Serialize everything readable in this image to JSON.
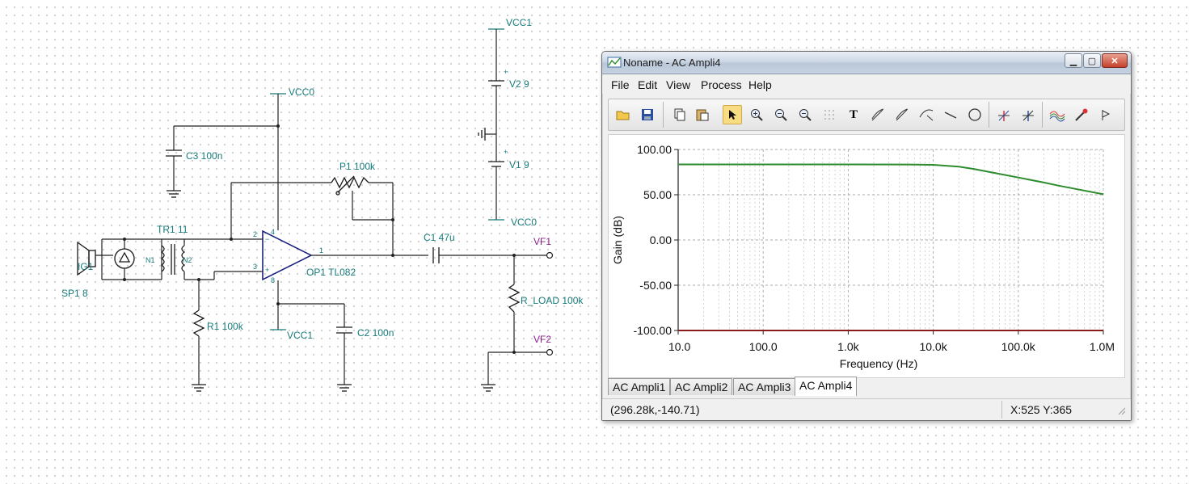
{
  "schematic": {
    "labels": {
      "vcc1_top": "VCC1",
      "v2": "V2 9",
      "v1": "V1 9",
      "vcc0_bottom": "VCC0",
      "vcc0_top": "VCC0",
      "c3": "C3 100n",
      "p1": "P1 100k",
      "tr1": "TR1 11",
      "n1": "N1",
      "n2": "N2",
      "ig1": "IG1",
      "sp1": "SP1 8",
      "r1": "R1 100k",
      "op1": "OP1 TL082",
      "vcc1_bottom": "VCC1",
      "c2": "C2 100n",
      "c1": "C1 47u",
      "vf1": "VF1",
      "vf2": "VF2",
      "r_load": "R_LOAD 100k",
      "pin1": "1",
      "pin2": "2",
      "pin3": "3",
      "pin4": "4",
      "pin8": "8",
      "plus": "+",
      "minus": "−"
    }
  },
  "window": {
    "title": "Noname - AC Ampli4",
    "caption_buttons": {
      "minimize": "▁",
      "maximize": "▢",
      "close": "✕"
    },
    "menu": [
      "File",
      "Edit",
      "View",
      "Process",
      "Help"
    ],
    "toolbar_icons": [
      "open-icon",
      "save-icon",
      "copy-icon",
      "paste-icon",
      "pointer-icon",
      "zoom-in-icon",
      "zoom-out-icon",
      "zoom-100-icon",
      "grid-icon",
      "text-icon",
      "cursor-a-icon",
      "cursor-b-icon",
      "tangent-icon",
      "line-icon",
      "circle-icon",
      "marker-a-icon",
      "marker-b-icon",
      "curves-icon",
      "probe-icon",
      "flag-icon"
    ],
    "tabs": [
      "AC Ampli1",
      "AC Ampli2",
      "AC Ampli3",
      "AC Ampli4"
    ],
    "active_tab": "AC Ampli4",
    "status": {
      "coords": "(296.28k,-140.71)",
      "xy": "X:525  Y:365"
    }
  },
  "chart_data": {
    "type": "line",
    "title": "",
    "xlabel": "Frequency (Hz)",
    "ylabel": "Gain (dB)",
    "x_scale": "log",
    "xlim": [
      10,
      1000000
    ],
    "ylim": [
      -100,
      100
    ],
    "x_ticks": [
      "10.0",
      "100.0",
      "1.0k",
      "10.0k",
      "100.0k",
      "1.0M"
    ],
    "y_ticks": [
      "100.00",
      "50.00",
      "0.00",
      "-50.00",
      "-100.00"
    ],
    "grid": true,
    "colors": {
      "gain": "#2e8b2e",
      "baseline": "#8b1a1a"
    },
    "series": [
      {
        "x": [
          10,
          100,
          1000,
          5000,
          10000,
          20000,
          30000,
          50000,
          100000,
          200000,
          300000,
          500000,
          1000000
        ],
        "values": [
          83.5,
          83.5,
          83.5,
          83.4,
          83.0,
          81.0,
          78.5,
          74.5,
          69.0,
          63.5,
          60.0,
          56.0,
          50.5
        ]
      },
      {
        "x": [
          10,
          1000000
        ],
        "values": [
          -100,
          -100
        ]
      }
    ]
  }
}
